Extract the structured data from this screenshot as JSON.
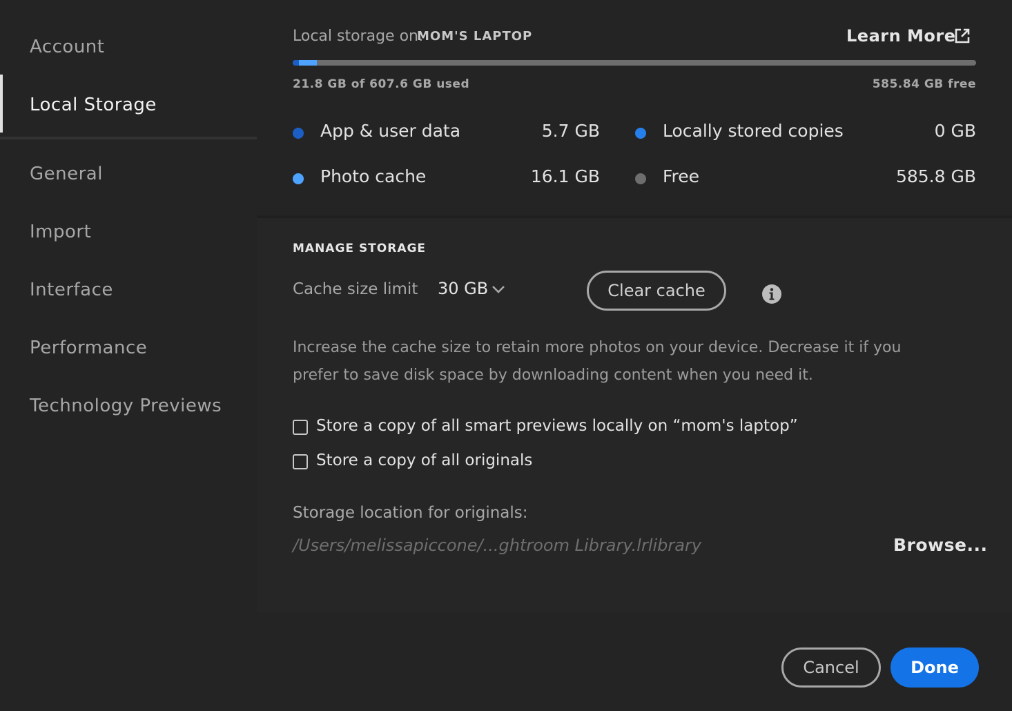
{
  "sidebar": {
    "items": [
      {
        "label": "Account",
        "active": false
      },
      {
        "label": "Local Storage",
        "active": true
      },
      {
        "label": "General",
        "active": false
      },
      {
        "label": "Import",
        "active": false
      },
      {
        "label": "Interface",
        "active": false
      },
      {
        "label": "Performance",
        "active": false
      },
      {
        "label": "Technology Previews",
        "active": false
      }
    ]
  },
  "storage": {
    "label": "Local storage on:",
    "device": "MOM'S LAPTOP",
    "learn_more": "Learn More",
    "learn_more_icon": "external-link-icon",
    "used_text": "21.8 GB of 607.6 GB used",
    "free_text": "585.84 GB free",
    "usage_fraction": {
      "app_user_data": 0.0094,
      "photo_cache": 0.0265
    },
    "legend": [
      {
        "label": "App & user data",
        "value": "5.7 GB",
        "color": "#1c5fc4"
      },
      {
        "label": "Locally stored copies",
        "value": "0 GB",
        "color": "#2680eb"
      },
      {
        "label": "Photo cache",
        "value": "16.1 GB",
        "color": "#4da3ff"
      },
      {
        "label": "Free",
        "value": "585.8 GB",
        "color": "#6e6e6e"
      }
    ]
  },
  "manage": {
    "heading": "MANAGE STORAGE",
    "cache_limit_label": "Cache size limit",
    "cache_limit_value": "30 GB",
    "clear_cache": "Clear cache",
    "info_icon": "info-icon",
    "description": "Increase the cache size to retain more photos on your device. Decrease it if you prefer to save disk space by downloading content when you need it.",
    "checkboxes": [
      {
        "label": "Store a copy of all smart previews locally on “mom's laptop”",
        "checked": false
      },
      {
        "label": "Store a copy of all originals",
        "checked": false
      }
    ],
    "location_label": "Storage location for originals:",
    "location_path": "/Users/melissapiccone/...ghtroom Library.lrlibrary",
    "browse": "Browse..."
  },
  "footer": {
    "cancel": "Cancel",
    "done": "Done"
  },
  "colors": {
    "accent": "#1473e6",
    "background": "#242424"
  }
}
